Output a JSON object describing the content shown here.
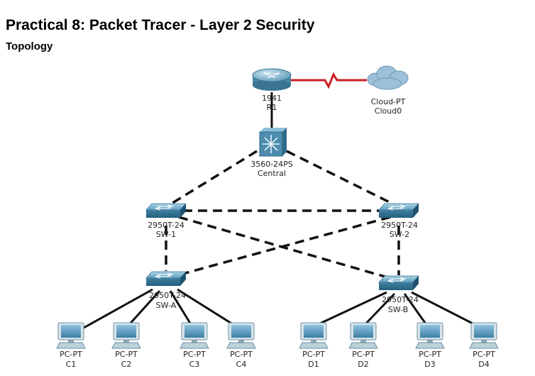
{
  "document": {
    "title": "Practical 8: Packet Tracer - Layer 2 Security",
    "subtitle": "Topology"
  },
  "devices": {
    "router": {
      "model": "1941",
      "name": "R1",
      "icon": "router-icon"
    },
    "cloud": {
      "model": "Cloud-PT",
      "name": "Cloud0",
      "icon": "cloud-icon"
    },
    "central": {
      "model": "3560-24PS",
      "name": "Central",
      "icon": "multilayer-switch-icon"
    },
    "sw1": {
      "model": "2950T-24",
      "name": "SW-1",
      "icon": "switch-icon"
    },
    "sw2": {
      "model": "2950T-24",
      "name": "SW-2",
      "icon": "switch-icon"
    },
    "swa": {
      "model": "2950T-24",
      "name": "SW-A",
      "icon": "switch-icon"
    },
    "swb": {
      "model": "2950T-24",
      "name": "SW-B",
      "icon": "switch-icon"
    },
    "pcs": [
      {
        "model": "PC-PT",
        "name": "C1"
      },
      {
        "model": "PC-PT",
        "name": "C2"
      },
      {
        "model": "PC-PT",
        "name": "C3"
      },
      {
        "model": "PC-PT",
        "name": "C4"
      },
      {
        "model": "PC-PT",
        "name": "D1"
      },
      {
        "model": "PC-PT",
        "name": "D2"
      },
      {
        "model": "PC-PT",
        "name": "D3"
      },
      {
        "model": "PC-PT",
        "name": "D4"
      }
    ]
  },
  "colors": {
    "serial_link": "#cc1f1f",
    "trunk_link": "#111111",
    "access_link": "#111111",
    "device_blue": "#4f8fb0"
  }
}
